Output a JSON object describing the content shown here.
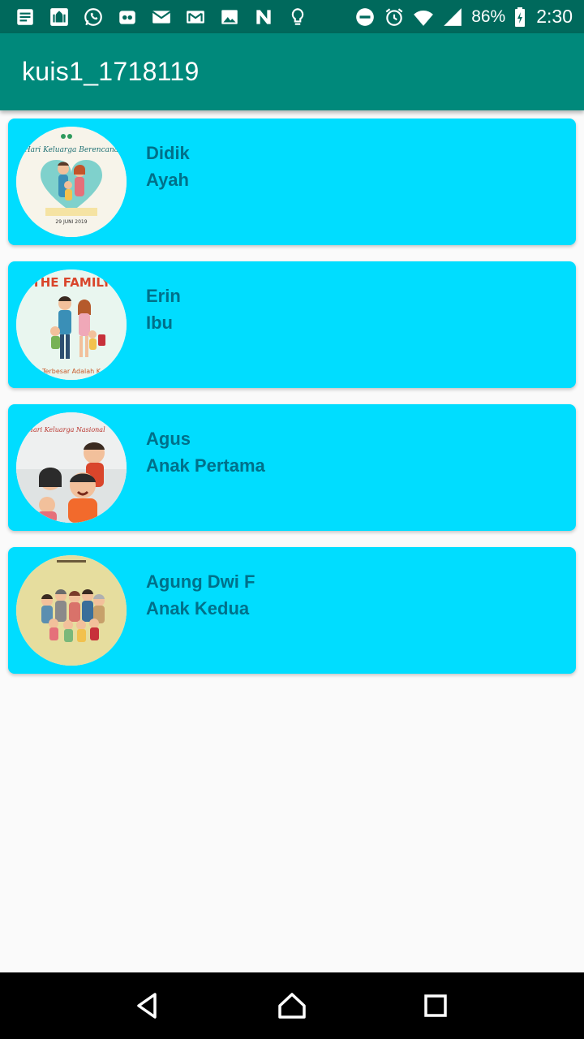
{
  "status_bar": {
    "battery": "86%",
    "time": "2:30",
    "left_icons": [
      "notes-icon",
      "mosque-app-icon",
      "whatsapp-icon",
      "tripadvisor-icon",
      "mail-icon",
      "gmail-icon",
      "photos-icon",
      "news-icon",
      "bulb-icon"
    ],
    "right_icons": [
      "do-not-disturb-icon",
      "alarm-icon",
      "wifi-icon",
      "signal-icon",
      "battery-icon"
    ]
  },
  "app_bar": {
    "title": "kuis1_1718119"
  },
  "colors": {
    "status_bar": "#00695c",
    "app_bar": "#00897b",
    "card": "#00ddff",
    "card_text": "#00708a",
    "background": "#fafafa"
  },
  "members": [
    {
      "name": "Didik",
      "role": "Ayah",
      "avatar": "family-day-poster"
    },
    {
      "name": "Erin",
      "role": "Ibu",
      "avatar": "the-family-poster"
    },
    {
      "name": "Agus",
      "role": "Anak Pertama",
      "avatar": "national-family-day-poster"
    },
    {
      "name": "Agung Dwi F",
      "role": "Anak Kedua",
      "avatar": "family-group-illustration"
    }
  ],
  "avatar_text": {
    "a1_title": "Hari Keluarga Berencana",
    "a1_date": "29 JUNI 2019",
    "a2_title": "THE FAMILY",
    "a2_sub": "Terbesar Adalah K",
    "a3_title": "Hari Keluarga Nasional"
  },
  "nav": {
    "back": "back-icon",
    "home": "home-icon",
    "recents": "recents-icon"
  }
}
